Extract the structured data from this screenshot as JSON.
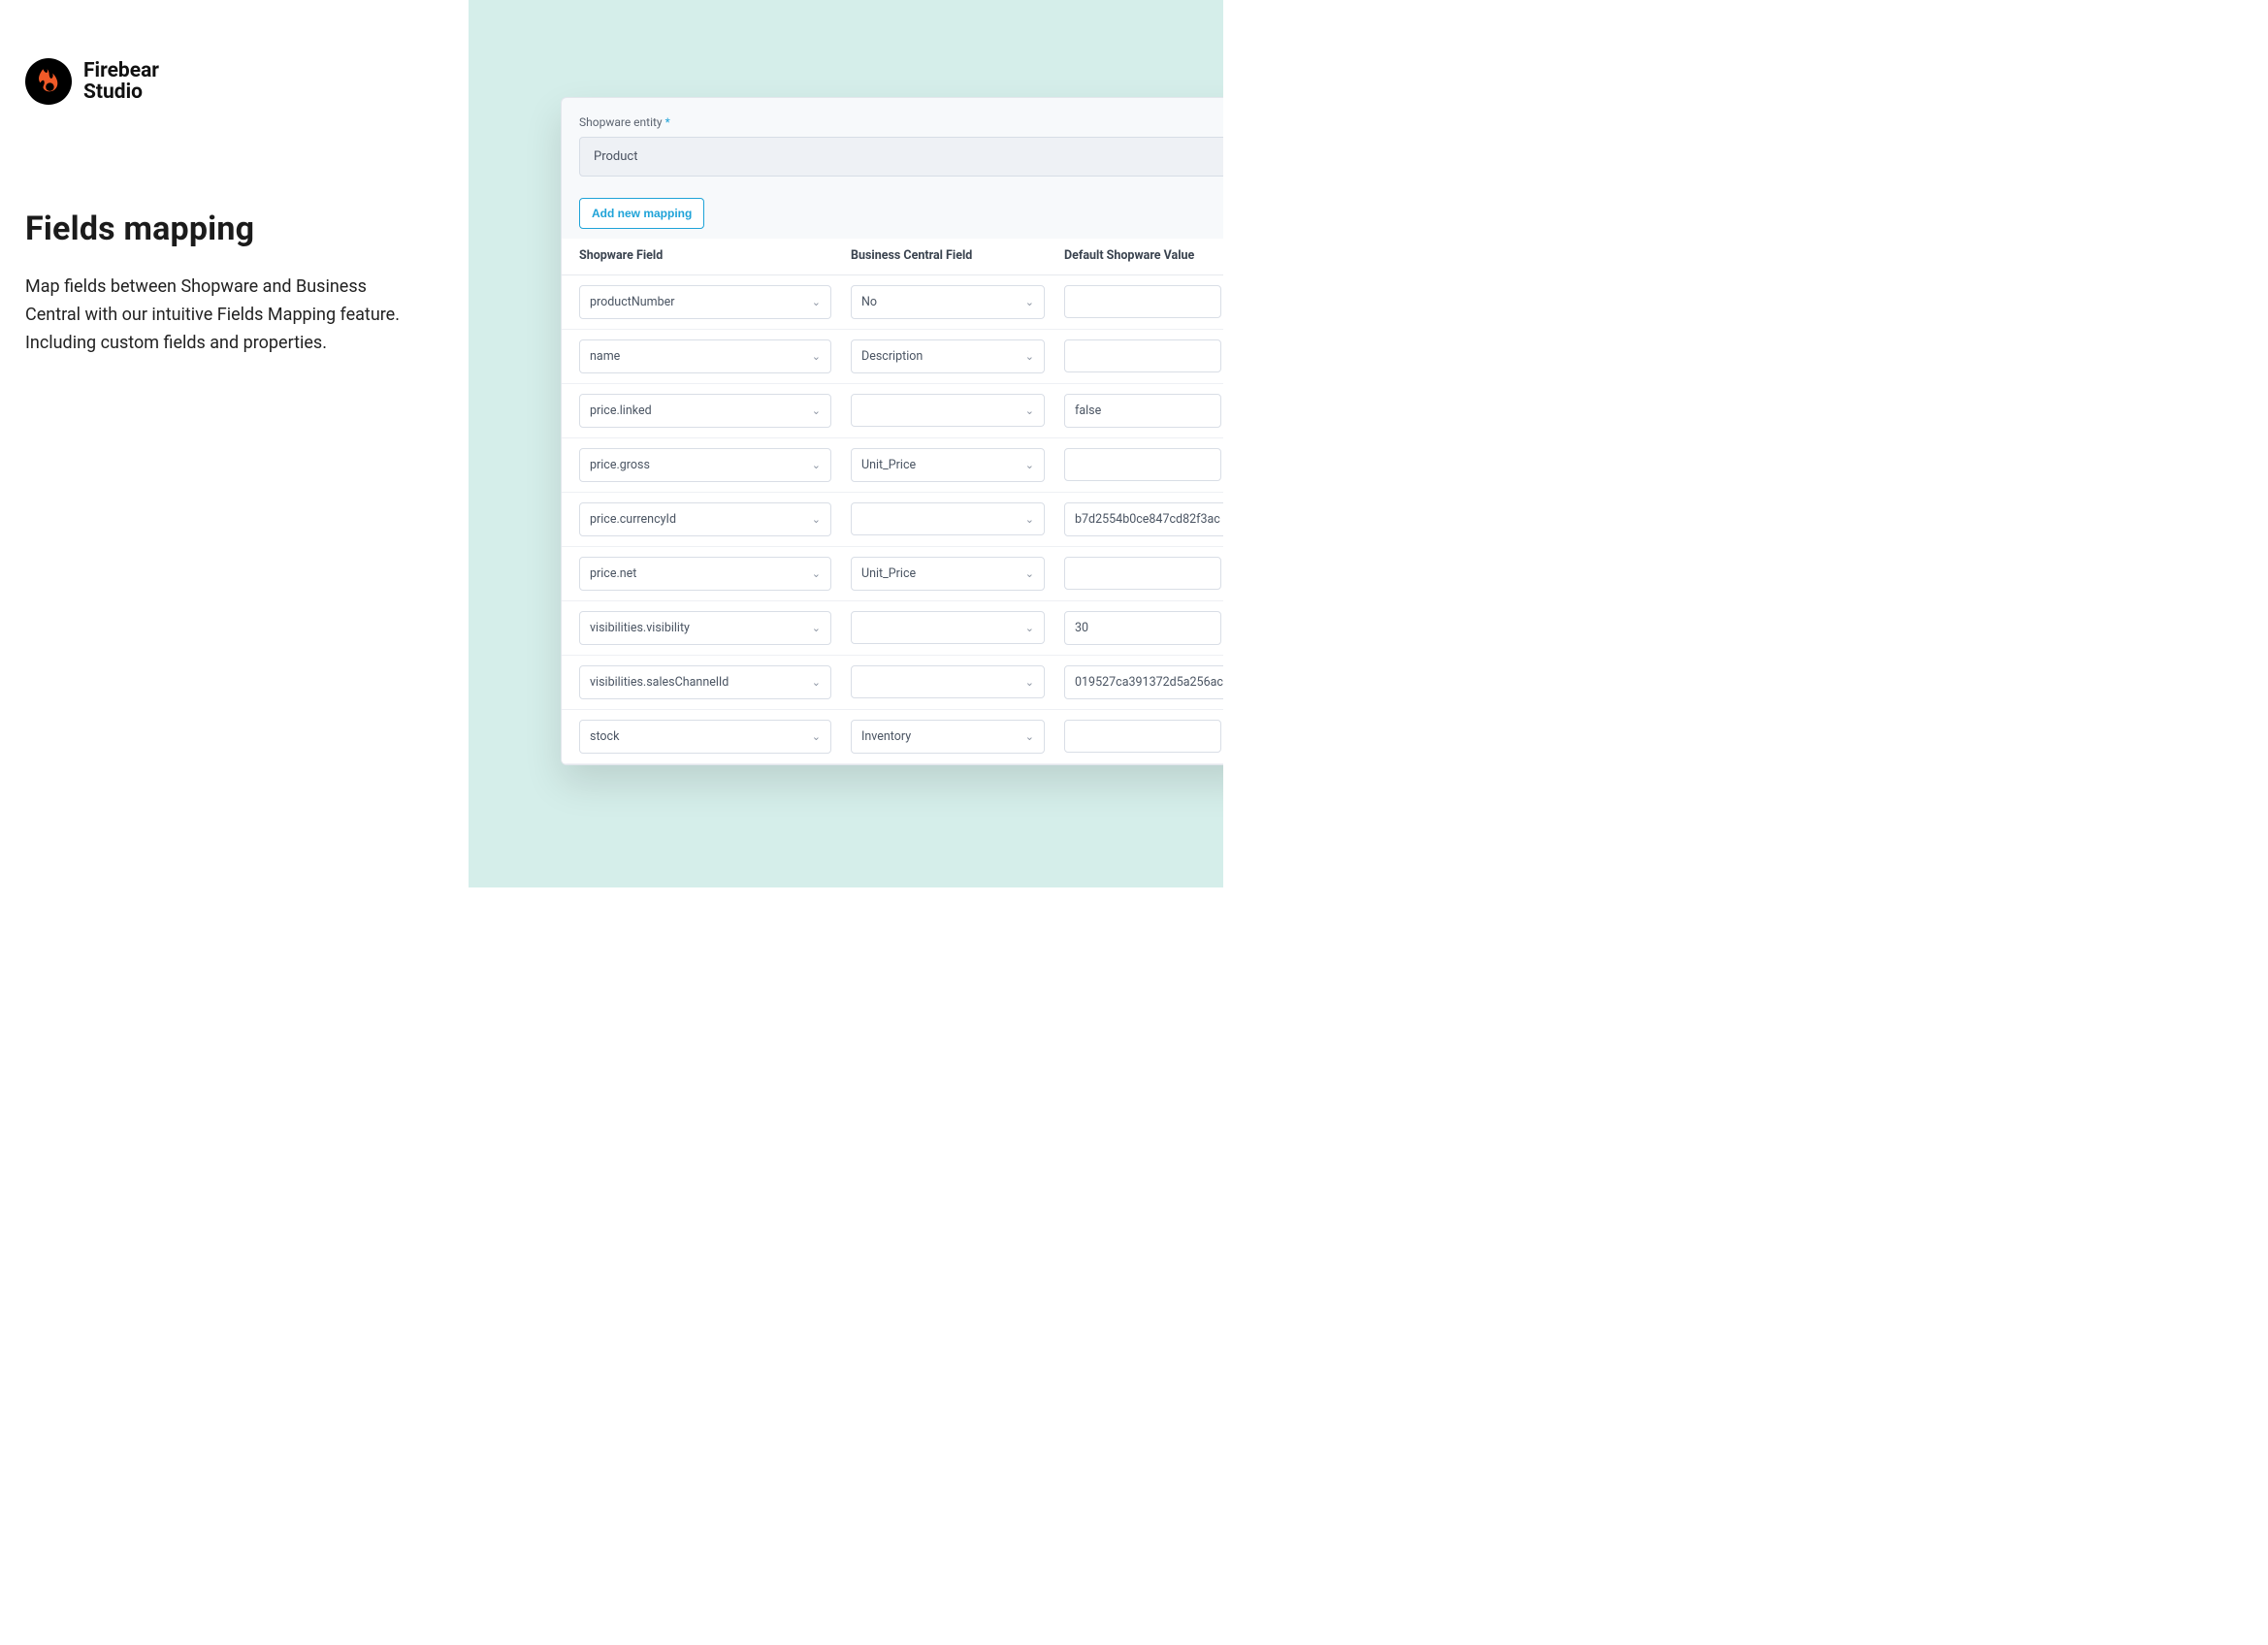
{
  "brand": {
    "line1": "Firebear",
    "line2": "Studio"
  },
  "headline": "Fields mapping",
  "subcopy": "Map fields between Shopware and Business Central with our intuitive Fields Mapping feature. Including custom fields and properties.",
  "card": {
    "entity_label": "Shopware entity",
    "entity_value": "Product",
    "add_button": "Add new mapping",
    "columns": {
      "shopware": "Shopware Field",
      "bc": "Business Central Field",
      "default": "Default Shopware Value"
    },
    "rows": [
      {
        "shopware": "productNumber",
        "bc": "No",
        "default": ""
      },
      {
        "shopware": "name",
        "bc": "Description",
        "default": ""
      },
      {
        "shopware": "price.linked",
        "bc": "",
        "default": "false"
      },
      {
        "shopware": "price.gross",
        "bc": "Unit_Price",
        "default": ""
      },
      {
        "shopware": "price.currencyId",
        "bc": "",
        "default": "b7d2554b0ce847cd82f3ac"
      },
      {
        "shopware": "price.net",
        "bc": "Unit_Price",
        "default": ""
      },
      {
        "shopware": "visibilities.visibility",
        "bc": "",
        "default": "30"
      },
      {
        "shopware": "visibilities.salesChannelId",
        "bc": "",
        "default": "019527ca391372d5a256ac"
      },
      {
        "shopware": "stock",
        "bc": "Inventory",
        "default": ""
      }
    ]
  }
}
